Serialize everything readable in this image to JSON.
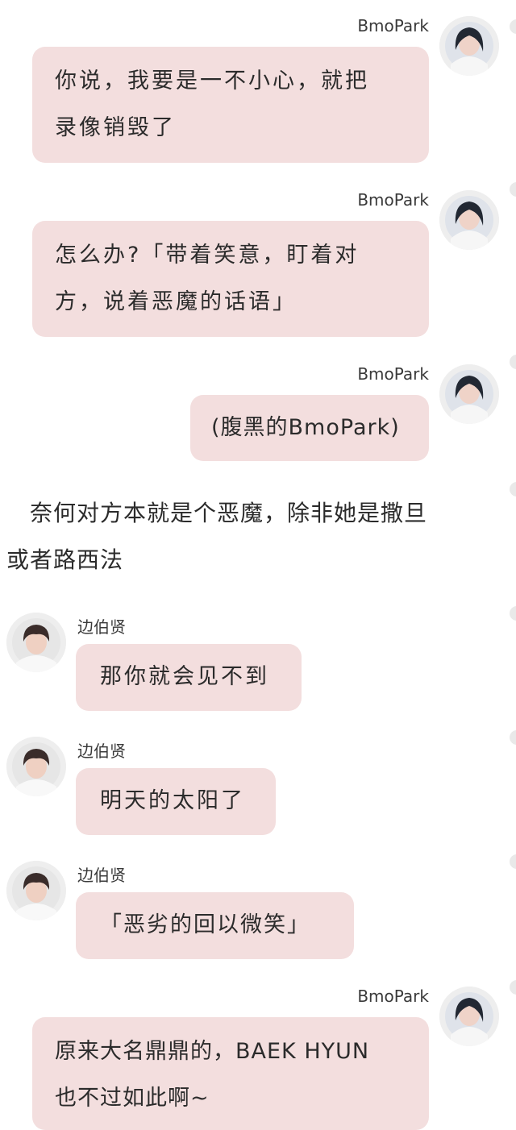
{
  "colors": {
    "bubble": "#f3dede",
    "avatar_ring": "#eeeeee",
    "background": "#ffffff"
  },
  "messages": [
    {
      "sender": "BmoPark",
      "side": "right",
      "avatar_icon": "bmopark-avatar-icon",
      "lines": [
        "你说，我要是一不小心，就把",
        "录像销毁了"
      ]
    },
    {
      "sender": "BmoPark",
      "side": "right",
      "avatar_icon": "bmopark-avatar-icon",
      "lines": [
        "怎么办?「带着笑意，盯着对",
        "方，说着恶魔的话语」"
      ]
    },
    {
      "sender": "BmoPark",
      "side": "right",
      "avatar_icon": "bmopark-avatar-icon",
      "lines": [
        "(腹黑的BmoPark)"
      ]
    },
    {
      "sender": "边伯贤",
      "side": "left",
      "avatar_icon": "baekhyun-avatar-icon",
      "lines": [
        "那你就会见不到"
      ]
    },
    {
      "sender": "边伯贤",
      "side": "left",
      "avatar_icon": "baekhyun-avatar-icon",
      "lines": [
        "明天的太阳了"
      ]
    },
    {
      "sender": "边伯贤",
      "side": "left",
      "avatar_icon": "baekhyun-avatar-icon",
      "lines": [
        "「恶劣的回以微笑」"
      ]
    },
    {
      "sender": "BmoPark",
      "side": "right",
      "avatar_icon": "bmopark-avatar-icon",
      "lines": [
        "原来大名鼎鼎的，BAEK HYUN",
        "也不过如此啊~"
      ]
    }
  ],
  "narration": {
    "line1": "　奈何对方本就是个恶魔，除非她是撒旦",
    "line2": "或者路西法"
  }
}
